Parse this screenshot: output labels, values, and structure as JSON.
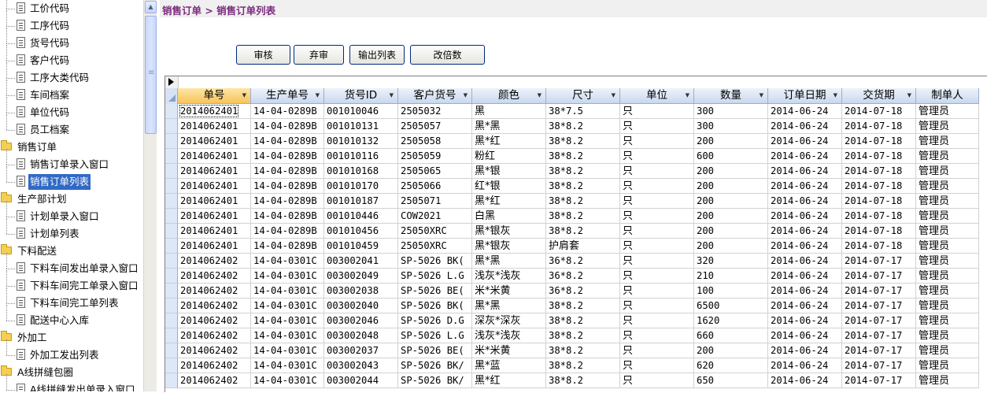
{
  "tree": {
    "items": [
      {
        "label": "工价代码",
        "type": "leaf",
        "selected": false
      },
      {
        "label": "工序代码",
        "type": "leaf",
        "selected": false
      },
      {
        "label": "货号代码",
        "type": "leaf",
        "selected": false
      },
      {
        "label": "客户代码",
        "type": "leaf",
        "selected": false
      },
      {
        "label": "工序大类代码",
        "type": "leaf",
        "selected": false
      },
      {
        "label": "车间档案",
        "type": "leaf",
        "selected": false
      },
      {
        "label": "单位代码",
        "type": "leaf",
        "selected": false
      },
      {
        "label": "员工档案",
        "type": "leaf",
        "selected": false
      },
      {
        "label": "销售订单",
        "type": "folder",
        "selected": false
      },
      {
        "label": "销售订单录入窗口",
        "type": "leaf",
        "selected": false
      },
      {
        "label": "销售订单列表",
        "type": "leaf",
        "selected": true
      },
      {
        "label": "生产部计划",
        "type": "folder",
        "selected": false
      },
      {
        "label": "计划单录入窗口",
        "type": "leaf",
        "selected": false
      },
      {
        "label": "计划单列表",
        "type": "leaf",
        "selected": false
      },
      {
        "label": "下料配送",
        "type": "folder",
        "selected": false
      },
      {
        "label": "下料车间发出单录入窗口",
        "type": "leaf",
        "selected": false
      },
      {
        "label": "下料车间完工单录入窗口",
        "type": "leaf",
        "selected": false
      },
      {
        "label": "下料车间完工单列表",
        "type": "leaf",
        "selected": false
      },
      {
        "label": "配送中心入库",
        "type": "leaf",
        "selected": false
      },
      {
        "label": "外加工",
        "type": "folder",
        "selected": false
      },
      {
        "label": "外加工发出列表",
        "type": "leaf",
        "selected": false
      },
      {
        "label": "A线拼缝包圈",
        "type": "folder",
        "selected": false
      },
      {
        "label": "A线拼缝发出单录入窗口",
        "type": "leaf",
        "selected": false
      }
    ]
  },
  "breadcrumb": "销售订单 > 销售订单列表",
  "toolbar": {
    "buttons": [
      {
        "name": "approve-button",
        "label": "审核"
      },
      {
        "name": "unapprove-button",
        "label": "弃审"
      },
      {
        "name": "export-list-button",
        "label": "输出列表"
      },
      {
        "name": "change-multiple-button",
        "label": "改倍数"
      }
    ]
  },
  "grid": {
    "columns": [
      "单号",
      "生产单号",
      "货号ID",
      "客户货号",
      "颜色",
      "尺寸",
      "单位",
      "数量",
      "订单日期",
      "交货期",
      "制单人"
    ],
    "rows": [
      [
        "2014062401",
        "14-04-0289B",
        "001010046",
        "2505032",
        "黑",
        "38*7.5",
        "只",
        "300",
        "2014-06-24",
        "2014-07-18",
        "管理员"
      ],
      [
        "2014062401",
        "14-04-0289B",
        "001010131",
        "2505057",
        "黑*黑",
        "38*8.2",
        "只",
        "300",
        "2014-06-24",
        "2014-07-18",
        "管理员"
      ],
      [
        "2014062401",
        "14-04-0289B",
        "001010132",
        "2505058",
        "黑*红",
        "38*8.2",
        "只",
        "200",
        "2014-06-24",
        "2014-07-18",
        "管理员"
      ],
      [
        "2014062401",
        "14-04-0289B",
        "001010116",
        "2505059",
        "粉红",
        "38*8.2",
        "只",
        "600",
        "2014-06-24",
        "2014-07-18",
        "管理员"
      ],
      [
        "2014062401",
        "14-04-0289B",
        "001010168",
        "2505065",
        "黑*银",
        "38*8.2",
        "只",
        "200",
        "2014-06-24",
        "2014-07-18",
        "管理员"
      ],
      [
        "2014062401",
        "14-04-0289B",
        "001010170",
        "2505066",
        "红*银",
        "38*8.2",
        "只",
        "200",
        "2014-06-24",
        "2014-07-18",
        "管理员"
      ],
      [
        "2014062401",
        "14-04-0289B",
        "001010187",
        "2505071",
        "黑*红",
        "38*8.2",
        "只",
        "200",
        "2014-06-24",
        "2014-07-18",
        "管理员"
      ],
      [
        "2014062401",
        "14-04-0289B",
        "001010446",
        "COW2021",
        "白黑",
        "38*8.2",
        "只",
        "200",
        "2014-06-24",
        "2014-07-18",
        "管理员"
      ],
      [
        "2014062401",
        "14-04-0289B",
        "001010456",
        "25050XRC",
        "黑*银灰",
        "38*8.2",
        "只",
        "200",
        "2014-06-24",
        "2014-07-18",
        "管理员"
      ],
      [
        "2014062401",
        "14-04-0289B",
        "001010459",
        "25050XRC",
        "黑*银灰",
        "护肩套",
        "只",
        "200",
        "2014-06-24",
        "2014-07-18",
        "管理员"
      ],
      [
        "2014062402",
        "14-04-0301C",
        "003002041",
        "SP-5026 BK(",
        "黑*黑",
        "36*8.2",
        "只",
        "320",
        "2014-06-24",
        "2014-07-17",
        "管理员"
      ],
      [
        "2014062402",
        "14-04-0301C",
        "003002049",
        "SP-5026 L.G",
        "浅灰*浅灰",
        "36*8.2",
        "只",
        "210",
        "2014-06-24",
        "2014-07-17",
        "管理员"
      ],
      [
        "2014062402",
        "14-04-0301C",
        "003002038",
        "SP-5026 BE(",
        "米*米黄",
        "36*8.2",
        "只",
        "100",
        "2014-06-24",
        "2014-07-17",
        "管理员"
      ],
      [
        "2014062402",
        "14-04-0301C",
        "003002040",
        "SP-5026 BK(",
        "黑*黑",
        "38*8.2",
        "只",
        "6500",
        "2014-06-24",
        "2014-07-17",
        "管理员"
      ],
      [
        "2014062402",
        "14-04-0301C",
        "003002046",
        "SP-5026 D.G",
        "深灰*深灰",
        "38*8.2",
        "只",
        "1620",
        "2014-06-24",
        "2014-07-17",
        "管理员"
      ],
      [
        "2014062402",
        "14-04-0301C",
        "003002048",
        "SP-5026 L.G",
        "浅灰*浅灰",
        "38*8.2",
        "只",
        "660",
        "2014-06-24",
        "2014-07-17",
        "管理员"
      ],
      [
        "2014062402",
        "14-04-0301C",
        "003002037",
        "SP-5026 BE(",
        "米*米黄",
        "38*8.2",
        "只",
        "200",
        "2014-06-24",
        "2014-07-17",
        "管理员"
      ],
      [
        "2014062402",
        "14-04-0301C",
        "003002043",
        "SP-5026 BK/",
        "黑*蓝",
        "38*8.2",
        "只",
        "620",
        "2014-06-24",
        "2014-07-17",
        "管理员"
      ],
      [
        "2014062402",
        "14-04-0301C",
        "003002044",
        "SP-5026 BK/",
        "黑*红",
        "38*8.2",
        "只",
        "650",
        "2014-06-24",
        "2014-07-17",
        "管理员"
      ]
    ]
  },
  "colors": {
    "breadcrumb_text": "#7b2c7d",
    "selection": "#316ac5",
    "button_border": "#00287a",
    "active_header": "#f8c35a"
  }
}
